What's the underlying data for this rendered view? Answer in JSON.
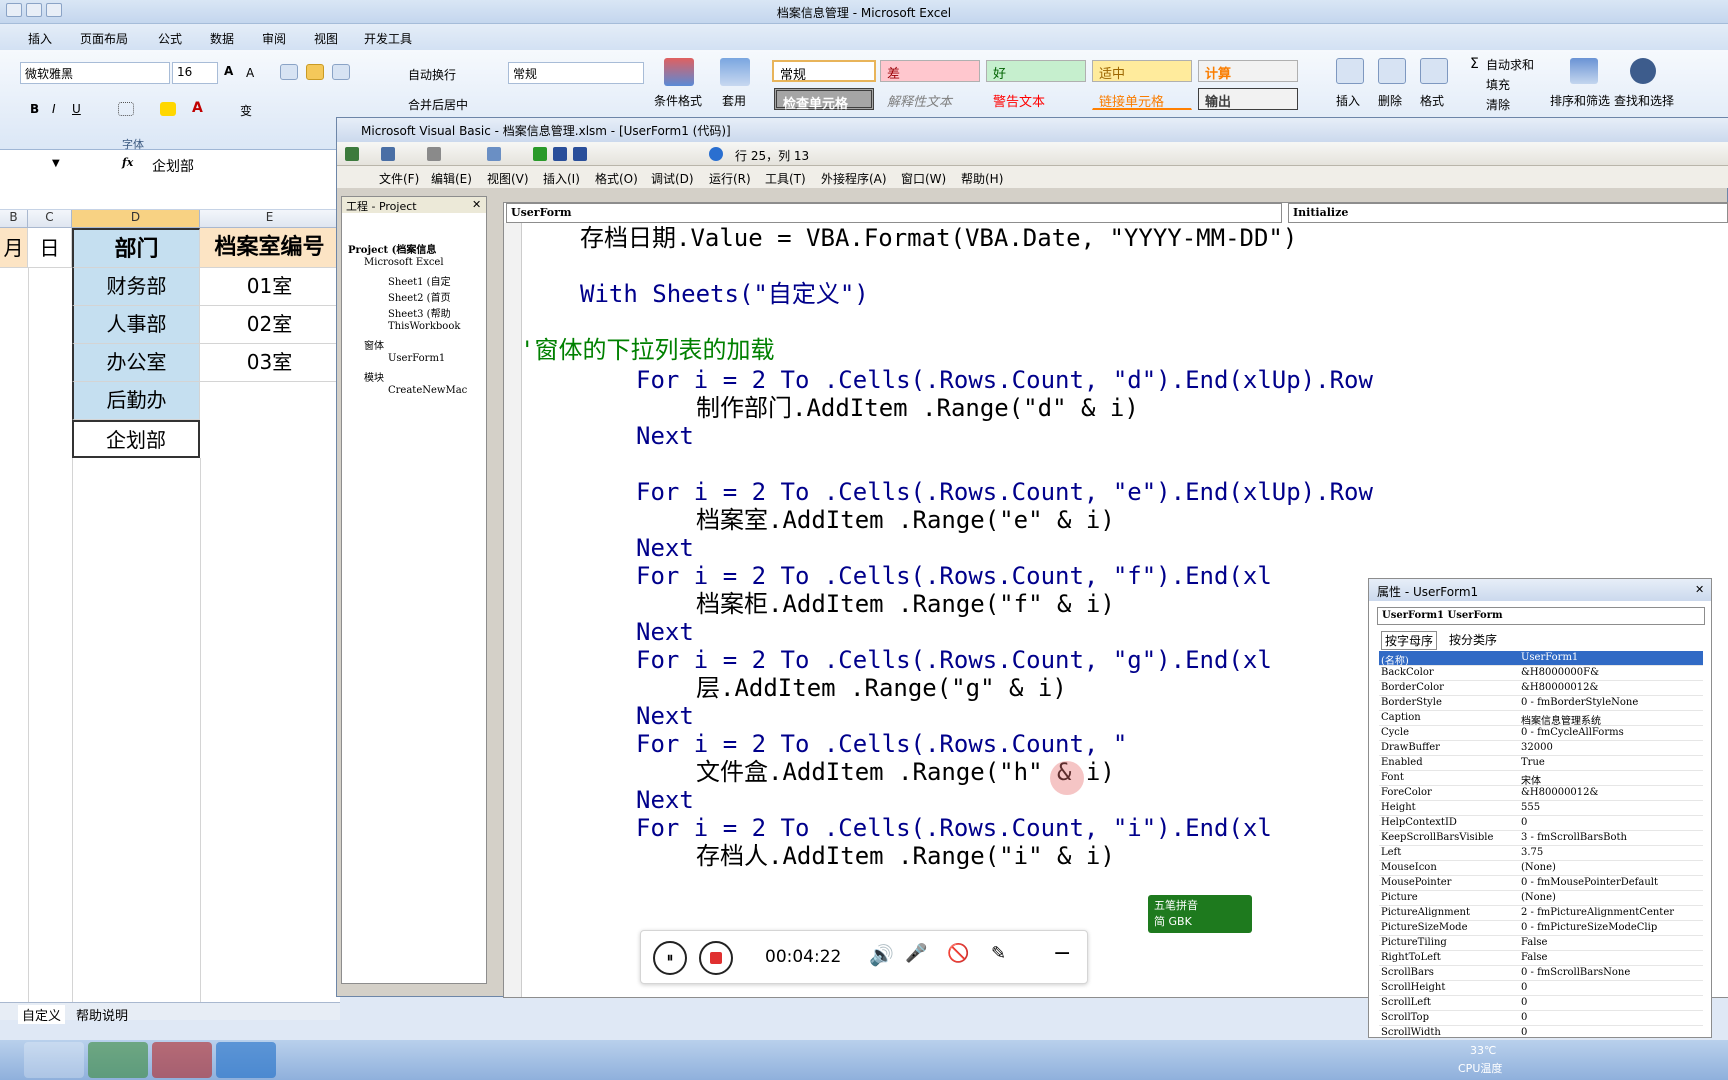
{
  "excel": {
    "title": "档案信息管理 - Microsoft Excel",
    "tabs": [
      "插入",
      "页面布局",
      "公式",
      "数据",
      "审阅",
      "视图",
      "开发工具"
    ],
    "font_name": "微软雅黑",
    "font_size": "16",
    "wrap_text": "自动换行",
    "merge_center": "合并后居中",
    "number_format": "常规",
    "font_group_label": "字体",
    "cond_format": "条件格式",
    "table_format": "套用",
    "styles": {
      "normal": "常规",
      "bad": "差",
      "good": "好",
      "neutral": "适中",
      "calc": "计算",
      "check_cell": "检查单元格",
      "explanatory": "解释性文本",
      "warning": "警告文本",
      "linked_cell": "链接单元格",
      "output": "输出"
    },
    "cells_buttons": [
      "插入",
      "删除",
      "格式"
    ],
    "autosum": "自动求和",
    "fill": "填充",
    "clear": "清除",
    "sort_filter": "排序和筛选",
    "find_select": "查找和选择",
    "formula_value": "企划部",
    "fx": "fx",
    "columns": [
      "B",
      "C",
      "D",
      "E"
    ],
    "header_row": [
      "月",
      "日",
      "部门",
      "档案室编号"
    ],
    "departments": [
      "财务部",
      "人事部",
      "办公室",
      "后勤办",
      "企划部"
    ],
    "rooms": [
      "01室",
      "02室",
      "03室"
    ],
    "sheet_tabs": [
      "自定义",
      "帮助说明"
    ]
  },
  "vbe": {
    "title": "Microsoft Visual Basic - 档案信息管理.xlsm - [UserForm1 (代码)]",
    "position": "行 25，列 13",
    "menu": [
      "文件(F)",
      "编辑(E)",
      "视图(V)",
      "插入(I)",
      "格式(O)",
      "调试(D)",
      "运行(R)",
      "工具(T)",
      "外接程序(A)",
      "窗口(W)",
      "帮助(H)"
    ],
    "project_title": "工程 - Project",
    "project_tree": [
      "Project (档案信息",
      "Microsoft Excel",
      "Sheet1 (自定",
      "Sheet2 (首页",
      "Sheet3 (帮助",
      "ThisWorkbook",
      "窗体",
      "UserForm1",
      "模块",
      "CreateNewMac"
    ],
    "object_combo": "UserForm",
    "proc_combo": "Initialize",
    "code_lines": [
      "存档日期.Value = VBA.Format(VBA.Date, \"YYYY-MM-DD\")",
      "With Sheets(\"自定义\")",
      "'窗体的下拉列表的加载",
      "For i = 2 To .Cells(.Rows.Count, \"d\").End(xlUp).Row",
      "制作部门.AddItem .Range(\"d\" & i)",
      "Next",
      "For i = 2 To .Cells(.Rows.Count, \"e\").End(xlUp).Row",
      "档案室.AddItem .Range(\"e\" & i)",
      "Next",
      "For i = 2 To .Cells(.Rows.Count, \"f\").End(xl",
      "档案柜.AddItem .Range(\"f\" & i)",
      "Next",
      "For i = 2 To .Cells(.Rows.Count, \"g\").End(xl",
      "层.AddItem .Range(\"g\" & i)",
      "Next",
      "For i = 2 To .Cells(.Rows.Count, \"",
      "文件盒.AddItem .Range(\"h\" & i)",
      "Next",
      "For i = 2 To .Cells(.Rows.Count, \"i\").End(xl",
      "存档人.AddItem .Range(\"i\" & i)"
    ],
    "ime": {
      "name": "五笔拼音",
      "mode": "简 GBK"
    }
  },
  "properties": {
    "title": "属性 - UserForm1",
    "object": "UserForm1 UserForm",
    "tabs": [
      "按字母序",
      "按分类序"
    ],
    "rows": [
      [
        "(名称)",
        "UserForm1"
      ],
      [
        "BackColor",
        "&H8000000F&"
      ],
      [
        "BorderColor",
        "&H80000012&"
      ],
      [
        "BorderStyle",
        "0 - fmBorderStyleNone"
      ],
      [
        "Caption",
        "档案信息管理系统"
      ],
      [
        "Cycle",
        "0 - fmCycleAllForms"
      ],
      [
        "DrawBuffer",
        "32000"
      ],
      [
        "Enabled",
        "True"
      ],
      [
        "Font",
        "宋体"
      ],
      [
        "ForeColor",
        "&H80000012&"
      ],
      [
        "Height",
        "555"
      ],
      [
        "HelpContextID",
        "0"
      ],
      [
        "KeepScrollBarsVisible",
        "3 - fmScrollBarsBoth"
      ],
      [
        "Left",
        "3.75"
      ],
      [
        "MouseIcon",
        "(None)"
      ],
      [
        "MousePointer",
        "0 - fmMousePointerDefault"
      ],
      [
        "Picture",
        "(None)"
      ],
      [
        "PictureAlignment",
        "2 - fmPictureAlignmentCenter"
      ],
      [
        "PictureSizeMode",
        "0 - fmPictureSizeModeClip"
      ],
      [
        "PictureTiling",
        "False"
      ],
      [
        "RightToLeft",
        "False"
      ],
      [
        "ScrollBars",
        "0 - fmScrollBarsNone"
      ],
      [
        "ScrollHeight",
        "0"
      ],
      [
        "ScrollLeft",
        "0"
      ],
      [
        "ScrollTop",
        "0"
      ],
      [
        "ScrollWidth",
        "0"
      ]
    ]
  },
  "recorder": {
    "time": "00:04:22"
  },
  "tray": {
    "temp": "33℃",
    "label": "CPU温度"
  }
}
